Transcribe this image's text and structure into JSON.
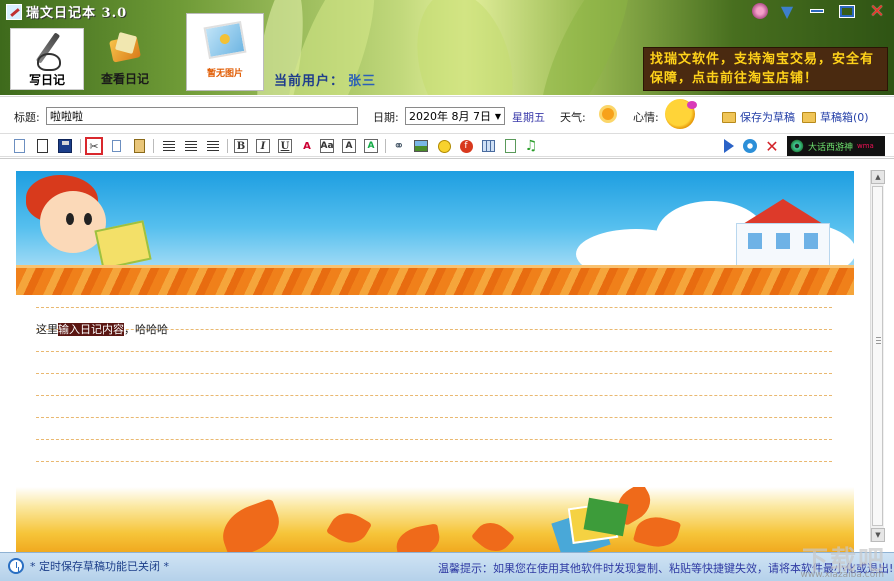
{
  "app": {
    "title": "瑞文日记本 3.0"
  },
  "nav": {
    "write_label": "写日记",
    "view_label": "查看日记"
  },
  "photo": {
    "caption": "暂无图片"
  },
  "user": {
    "label": "当前用户：",
    "name": "张三"
  },
  "promo": {
    "text": "找瑞文软件，支持淘宝交易，安全有保障，点击前往淘宝店铺！"
  },
  "entry": {
    "title_label": "标题:",
    "title_value": "啦啦啦",
    "date_label": "日期:",
    "date_value": "2020年 8月 7日",
    "weekday": "星期五",
    "weather_label": "天气:",
    "weather_icon": "sun-icon",
    "mood_label": "心情:",
    "mood_icon": "smiley-icon",
    "save_draft_label": "保存为草稿",
    "drafts_label": "草稿箱(0)"
  },
  "toolbar": {
    "music_label": "大话西游神"
  },
  "editor": {
    "text_before": "这里",
    "text_selected": "输入日记内容",
    "text_after": "，哈哈哈"
  },
  "status": {
    "left": "* 定时保存草稿功能已关闭 *",
    "right": "温馨提示：如果您在使用其他软件时发现复制、粘贴等快捷键失效，请将本软件最小化或退出!",
    "watermark": "下载吧",
    "watermark_sub": "www.xiazaiba.com"
  },
  "colors": {
    "promo_bg": "#4a2a10",
    "promo_text": "#ffd21a",
    "selection_bg": "#5a1612",
    "status_bg": "#cfe3f4"
  }
}
